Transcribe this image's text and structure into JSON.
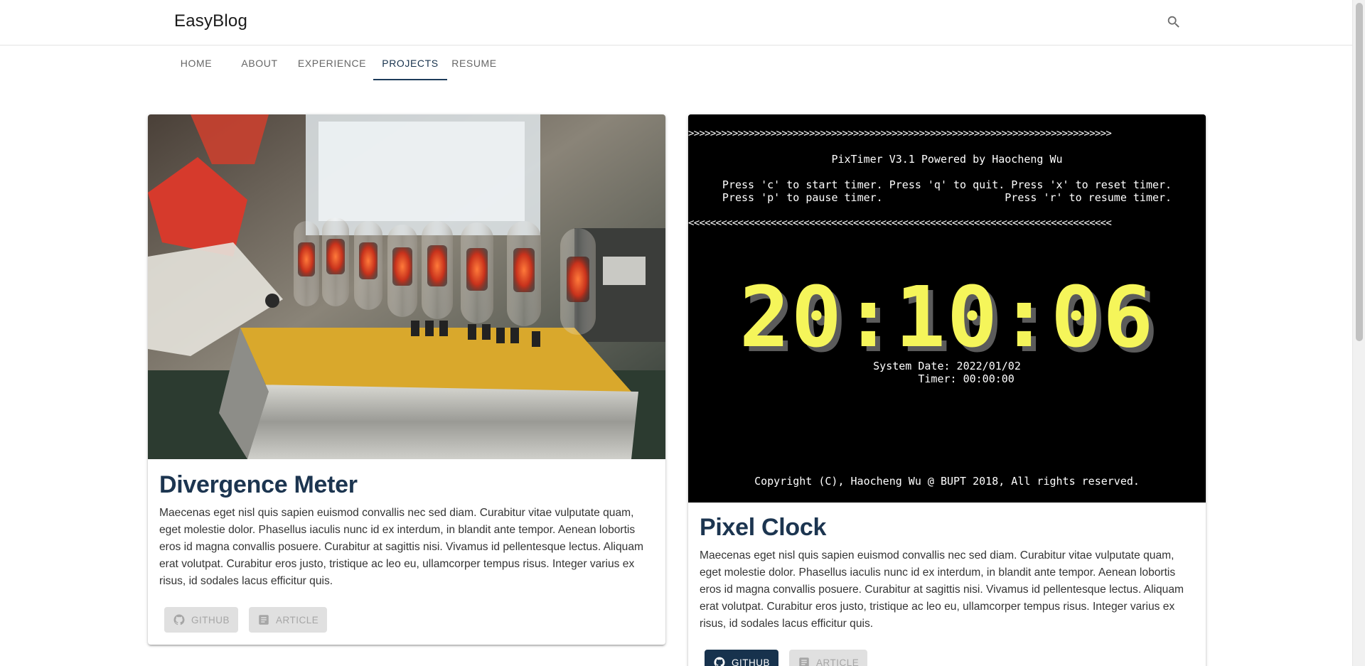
{
  "header": {
    "brand": "EasyBlog",
    "search_icon": "search-icon"
  },
  "tabs": [
    {
      "label": "HOME",
      "active": false
    },
    {
      "label": "ABOUT",
      "active": false
    },
    {
      "label": "EXPERIENCE",
      "active": false
    },
    {
      "label": "PROJECTS",
      "active": true
    },
    {
      "label": "RESUME",
      "active": false
    }
  ],
  "colors": {
    "accent": "#17324d",
    "title": "#1c3550",
    "button_disabled_bg": "#e0e0e0",
    "timer_digits": "#f5f55a"
  },
  "projects": [
    {
      "title": "Divergence Meter",
      "description": "Maecenas eget nisl quis sapien euismod convallis nec sed diam. Curabitur vitae vulputate quam, eget molestie dolor. Phasellus iaculis nunc id ex interdum, in blandit ante tempor. Aenean lobortis eros id magna convallis posuere. Curabitur at sagittis nisi. Vivamus id pellentesque lectus. Aliquam erat volutpat. Curabitur eros justo, tristique ac leo eu, ullamcorper tempus risus. Integer varius ex risus, id sodales lacus efficitur quis.",
      "media_description": "nixie tube clock photo",
      "buttons": {
        "github": {
          "label": "GITHUB",
          "icon": "github-icon",
          "state": "disabled"
        },
        "article": {
          "label": "ARTICLE",
          "icon": "article-icon",
          "state": "disabled"
        }
      }
    },
    {
      "title": "Pixel Clock",
      "description": "Maecenas eget nisl quis sapien euismod convallis nec sed diam. Curabitur vitae vulputate quam, eget molestie dolor. Phasellus iaculis nunc id ex interdum, in blandit ante tempor. Aenean lobortis eros id magna convallis posuere. Curabitur at sagittis nisi. Vivamus id pellentesque lectus. Aliquam erat volutpat. Curabitur eros justo, tristique ac leo eu, ullamcorper tempus risus. Integer varius ex risus, id sodales lacus efficitur quis.",
      "buttons": {
        "github": {
          "label": "GITHUB",
          "icon": "github-icon",
          "state": "primary"
        },
        "article": {
          "label": "ARTICLE",
          "icon": "article-icon",
          "state": "disabled"
        }
      },
      "terminal": {
        "arrows_right": ">>>>>>>>>>>>>>>>>>>>>>>>>>>>>>>>>>>>>>>>>>>>>>>>>>>>>>>>>>>>>>>>>>>>>>>>>>>>>",
        "header": "PixTimer V3.1 Powered by Haocheng Wu",
        "help_line_1": "Press 'c' to start timer. Press 'q' to quit. Press 'x' to reset timer.",
        "help_line_2": "Press 'p' to pause timer.                   Press 'r' to resume timer.",
        "arrows_left": "<<<<<<<<<<<<<<<<<<<<<<<<<<<<<<<<<<<<<<<<<<<<<<<<<<<<<<<<<<<<<<<<<<<<<<<<<<<<<",
        "big_time": "20:10:06",
        "system_date": "System Date: 2022/01/02",
        "timer": "      Timer: 00:00:00",
        "copyright": "Copyright (C), Haocheng Wu @ BUPT 2018, All rights reserved."
      }
    }
  ]
}
